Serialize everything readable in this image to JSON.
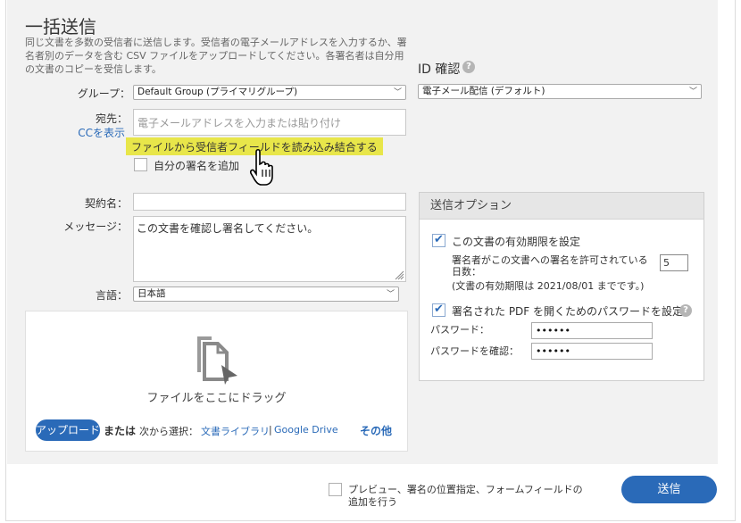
{
  "page": {
    "title": "一括送信",
    "description": "同じ文書を多数の受信者に送信します。受信者の電子メールアドレスを入力するか、署名者別のデータを含む CSV ファイルをアップロードしてください。各署名者は自分用の文書のコピーを受信します。"
  },
  "form": {
    "group_label": "グループ：",
    "group_value": "Default Group (プライマリグループ)",
    "recipient_label": "宛先：",
    "cc_link": "CCを表示",
    "recipient_placeholder": "電子メールアドレスを入力または貼り付け",
    "import_tooltip": "ファイルから受信者フィールドを読み込み結合する",
    "add_me_label": "自分の署名を追加",
    "agreement_label": "契約名：",
    "agreement_value": "",
    "message_label": "メッセージ：",
    "message_value": "この文書を確認し署名してください。",
    "language_label": "言語：",
    "language_value": "日本語"
  },
  "dropzone": {
    "drag_text": "ファイルをここにドラッグ",
    "upload_button": "アップロード",
    "or_text": "または",
    "select_from": "次から選択：",
    "library_link": "文書ライブラリ",
    "separator": "|",
    "drive_link": "Google Drive",
    "more_link": "その他"
  },
  "id_check": {
    "title": "ID 確認",
    "value": "電子メール配信 (デフォルト)"
  },
  "options": {
    "title": "送信オプション",
    "expiry_label": "この文書の有効期限を設定",
    "expiry_checked": true,
    "days_label": "署名者がこの文書への署名を許可されている日数：",
    "days_value": "5",
    "expiry_note": "(文書の有効期限は 2021/08/01 までです。)",
    "password_label": "署名された PDF を開くためのパスワードを設定",
    "password_checked": true,
    "password_field_label": "パスワード：",
    "password_value": "••••••",
    "confirm_field_label": "パスワードを確認：",
    "confirm_value": "••••••"
  },
  "footer": {
    "preview_label_line1": "プレビュー、署名の位置指定、フォームフィールドの",
    "preview_label_line2": "追加を行う",
    "send_button": "送信"
  },
  "colors": {
    "accent": "#2a6ab8",
    "tooltip": "#e8e64a",
    "panel": "#f2f2f2"
  }
}
